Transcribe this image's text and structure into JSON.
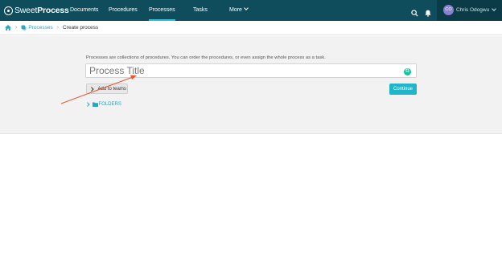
{
  "app": {
    "logo_light": "Sweet",
    "logo_bold": "Process"
  },
  "nav": {
    "items": [
      {
        "label": "Documents"
      },
      {
        "label": "Procedures"
      },
      {
        "label": "Processes",
        "active": true
      },
      {
        "label": "Tasks"
      },
      {
        "label": "More"
      }
    ],
    "search_icon": "search-icon",
    "bell_icon": "bell-icon"
  },
  "user": {
    "initials": "CO",
    "name": "Chris Odogwu"
  },
  "breadcrumb": {
    "home_icon": "home-icon",
    "processes_label": "Processes",
    "current": "Create process"
  },
  "form": {
    "description": "Processes are collections of procedures. You can order the procedures, or even assign the whole process as a task.",
    "title_placeholder": "Process Title",
    "title_value": "",
    "grammar_icon": "G",
    "add_to_teams_label": "Add to teams",
    "continue_label": "Continue",
    "folders_label": "FOLDERS"
  },
  "colors": {
    "topbar": "#0f4c5c",
    "accent": "#1fb6c9",
    "annotation_arrow": "#e8552f"
  }
}
